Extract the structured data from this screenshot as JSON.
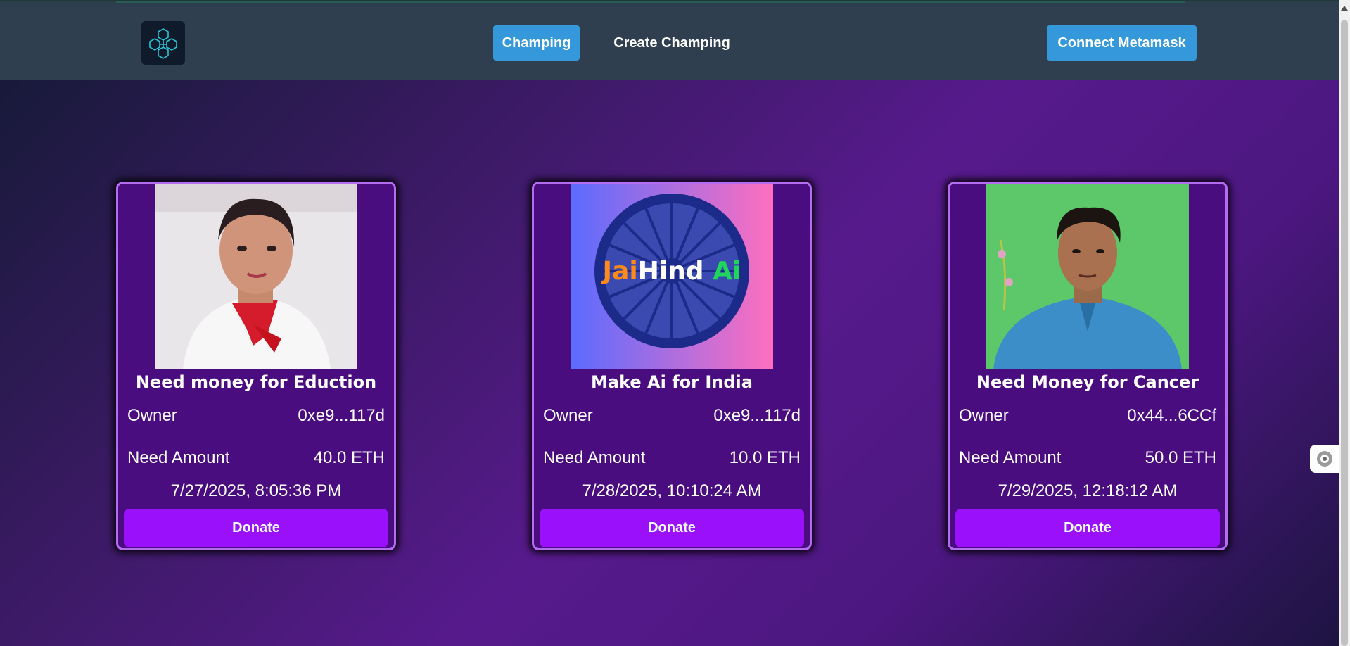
{
  "nav": {
    "tabs": [
      {
        "label": "Champing",
        "active": true
      },
      {
        "label": "Create Champing",
        "active": false
      }
    ],
    "connect_label": "Connect Metamask",
    "logo_icon": "blockchain-cubes-icon"
  },
  "campaigns": [
    {
      "title": "Need money for Eduction",
      "owner_label": "Owner",
      "owner": "0xe9...117d",
      "amount_label": "Need Amount",
      "amount": "40.0 ETH",
      "date": "7/27/2025, 8:05:36 PM",
      "donate_label": "Donate"
    },
    {
      "title": "Make Ai for India",
      "owner_label": "Owner",
      "owner": "0xe9...117d",
      "amount_label": "Need Amount",
      "amount": "10.0 ETH",
      "date": "7/28/2025, 10:10:24 AM",
      "donate_label": "Donate",
      "image_text": {
        "part1": "Jai",
        "part2": "Hind",
        "part3": " Ai"
      }
    },
    {
      "title": "Need Money for Cancer",
      "owner_label": "Owner",
      "owner": "0x44...6CCf",
      "amount_label": "Need Amount",
      "amount": "50.0 ETH",
      "date": "7/29/2025, 12:18:12 AM",
      "donate_label": "Donate"
    }
  ],
  "colors": {
    "nav_bg": "#2f3f4f",
    "accent": "#3498db",
    "card_bg": "#4a0d80",
    "card_border": "#b46df0",
    "donate": "#9b10fa"
  }
}
